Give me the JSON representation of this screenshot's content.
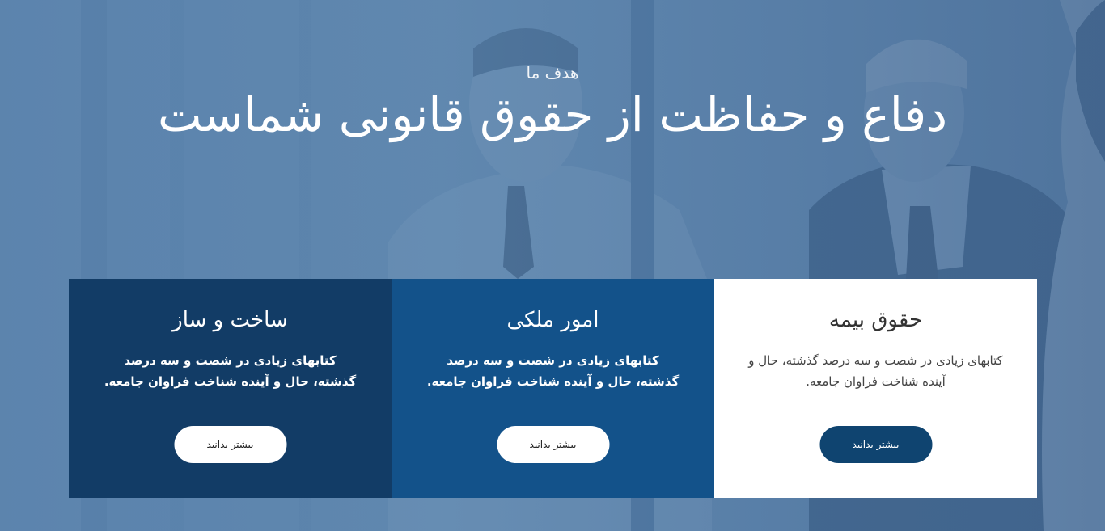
{
  "hero": {
    "subtitle": "هدف ما",
    "title": "دفاع و حفاظت از حقوق قانونی شماست"
  },
  "cards": [
    {
      "title": "ساخت و ساز",
      "text": "کتابهای زیادی در شصت و سه درصد گذشته، حال و آینده شناخت فراوان جامعه.",
      "button": "بیشتر بدانید"
    },
    {
      "title": "امور ملکی",
      "text": "کتابهای زیادی در شصت و سه درصد گذشته، حال و آینده شناخت فراوان جامعه.",
      "button": "بیشتر بدانید"
    },
    {
      "title": "حقوق بیمه",
      "text": "کتابهای زیادی در شصت و سه درصد گذشته، حال و آینده شناخت فراوان جامعه.",
      "button": "بیشتر بدانید"
    }
  ],
  "colors": {
    "overlay_blue": "#5d86ad",
    "card_dark": "#123c66",
    "card_mid": "#13528a",
    "card_light": "#ffffff",
    "button_navy": "#0f4470"
  }
}
